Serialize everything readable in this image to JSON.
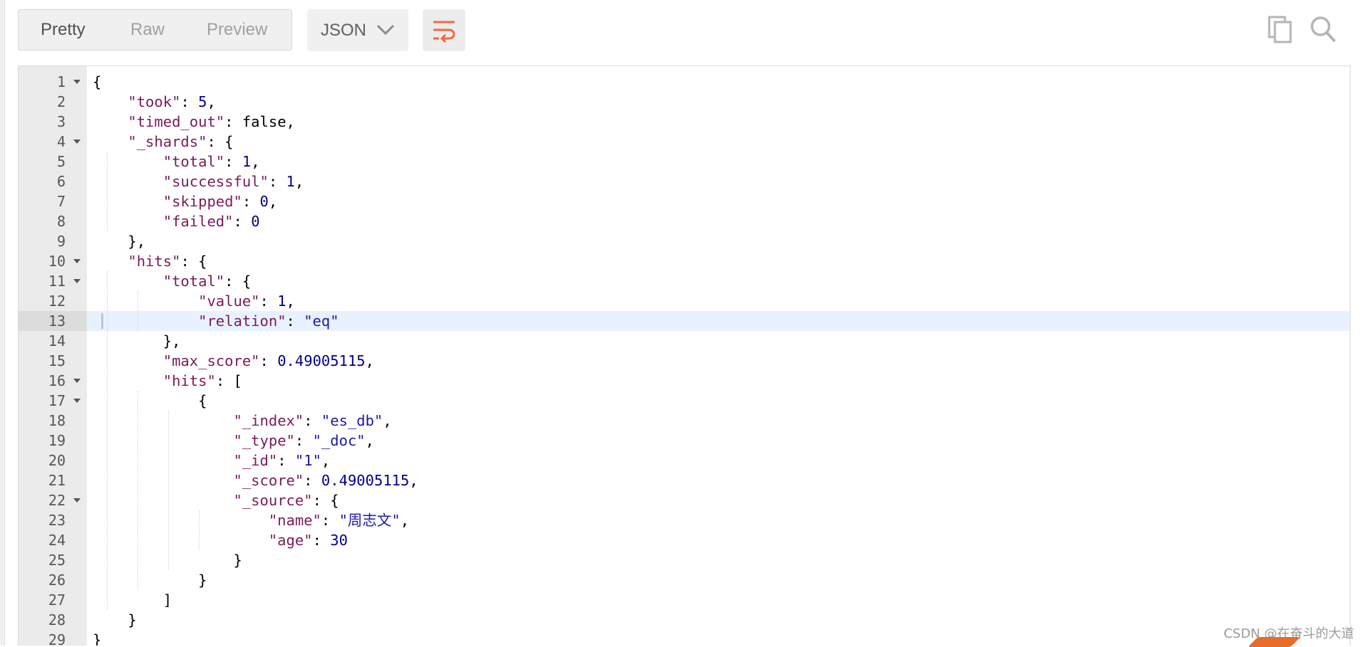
{
  "toolbar": {
    "view_tabs": [
      "Pretty",
      "Raw",
      "Preview"
    ],
    "active_tab": "Pretty",
    "format": "JSON",
    "icons": {
      "format_dropdown": "chevron-down-icon",
      "wrap": "wrap-lines-icon",
      "copy": "copy-icon",
      "search": "search-icon"
    },
    "accent_color": "#f26b3a"
  },
  "editor": {
    "active_line": 13,
    "lines": [
      {
        "n": "1",
        "fold": true
      },
      {
        "n": "2"
      },
      {
        "n": "3"
      },
      {
        "n": "4",
        "fold": true
      },
      {
        "n": "5"
      },
      {
        "n": "6"
      },
      {
        "n": "7"
      },
      {
        "n": "8"
      },
      {
        "n": "9"
      },
      {
        "n": "10",
        "fold": true
      },
      {
        "n": "11",
        "fold": true
      },
      {
        "n": "12"
      },
      {
        "n": "13"
      },
      {
        "n": "14"
      },
      {
        "n": "15"
      },
      {
        "n": "16",
        "fold": true
      },
      {
        "n": "17",
        "fold": true
      },
      {
        "n": "18"
      },
      {
        "n": "19"
      },
      {
        "n": "20"
      },
      {
        "n": "21"
      },
      {
        "n": "22",
        "fold": true
      },
      {
        "n": "23"
      },
      {
        "n": "24"
      },
      {
        "n": "25"
      },
      {
        "n": "26"
      },
      {
        "n": "27"
      },
      {
        "n": "28"
      },
      {
        "n": "29"
      }
    ],
    "code": [
      [
        [
          "p",
          "{"
        ]
      ],
      [
        [
          "i",
          "    "
        ],
        [
          "k",
          "\"took\""
        ],
        [
          "p",
          ": "
        ],
        [
          "n",
          "5"
        ],
        [
          "p",
          ","
        ]
      ],
      [
        [
          "i",
          "    "
        ],
        [
          "k",
          "\"timed_out\""
        ],
        [
          "p",
          ": false,"
        ]
      ],
      [
        [
          "i",
          "    "
        ],
        [
          "k",
          "\"_shards\""
        ],
        [
          "p",
          ": {"
        ]
      ],
      [
        [
          "i",
          "        "
        ],
        [
          "k",
          "\"total\""
        ],
        [
          "p",
          ": "
        ],
        [
          "n",
          "1"
        ],
        [
          "p",
          ","
        ]
      ],
      [
        [
          "i",
          "        "
        ],
        [
          "k",
          "\"successful\""
        ],
        [
          "p",
          ": "
        ],
        [
          "n",
          "1"
        ],
        [
          "p",
          ","
        ]
      ],
      [
        [
          "i",
          "        "
        ],
        [
          "k",
          "\"skipped\""
        ],
        [
          "p",
          ": "
        ],
        [
          "n",
          "0"
        ],
        [
          "p",
          ","
        ]
      ],
      [
        [
          "i",
          "        "
        ],
        [
          "k",
          "\"failed\""
        ],
        [
          "p",
          ": "
        ],
        [
          "n",
          "0"
        ]
      ],
      [
        [
          "i",
          "    "
        ],
        [
          "p",
          "},"
        ]
      ],
      [
        [
          "i",
          "    "
        ],
        [
          "k",
          "\"hits\""
        ],
        [
          "p",
          ": {"
        ]
      ],
      [
        [
          "i",
          "        "
        ],
        [
          "k",
          "\"total\""
        ],
        [
          "p",
          ": {"
        ]
      ],
      [
        [
          "i",
          "            "
        ],
        [
          "k",
          "\"value\""
        ],
        [
          "p",
          ": "
        ],
        [
          "n",
          "1"
        ],
        [
          "p",
          ","
        ]
      ],
      [
        [
          "i",
          "            "
        ],
        [
          "k",
          "\"relation\""
        ],
        [
          "p",
          ": "
        ],
        [
          "s",
          "\"eq\""
        ]
      ],
      [
        [
          "i",
          "        "
        ],
        [
          "p",
          "},"
        ]
      ],
      [
        [
          "i",
          "        "
        ],
        [
          "k",
          "\"max_score\""
        ],
        [
          "p",
          ": "
        ],
        [
          "n",
          "0.49005115"
        ],
        [
          "p",
          ","
        ]
      ],
      [
        [
          "i",
          "        "
        ],
        [
          "k",
          "\"hits\""
        ],
        [
          "p",
          ": ["
        ]
      ],
      [
        [
          "i",
          "            "
        ],
        [
          "p",
          "{"
        ]
      ],
      [
        [
          "i",
          "                "
        ],
        [
          "k",
          "\"_index\""
        ],
        [
          "p",
          ": "
        ],
        [
          "s",
          "\"es_db\""
        ],
        [
          "p",
          ","
        ]
      ],
      [
        [
          "i",
          "                "
        ],
        [
          "k",
          "\"_type\""
        ],
        [
          "p",
          ": "
        ],
        [
          "s",
          "\"_doc\""
        ],
        [
          "p",
          ","
        ]
      ],
      [
        [
          "i",
          "                "
        ],
        [
          "k",
          "\"_id\""
        ],
        [
          "p",
          ": "
        ],
        [
          "s",
          "\"1\""
        ],
        [
          "p",
          ","
        ]
      ],
      [
        [
          "i",
          "                "
        ],
        [
          "k",
          "\"_score\""
        ],
        [
          "p",
          ": "
        ],
        [
          "n",
          "0.49005115"
        ],
        [
          "p",
          ","
        ]
      ],
      [
        [
          "i",
          "                "
        ],
        [
          "k",
          "\"_source\""
        ],
        [
          "p",
          ": {"
        ]
      ],
      [
        [
          "i",
          "                    "
        ],
        [
          "k",
          "\"name\""
        ],
        [
          "p",
          ": "
        ],
        [
          "s",
          "\"周志文\""
        ],
        [
          "p",
          ","
        ]
      ],
      [
        [
          "i",
          "                    "
        ],
        [
          "k",
          "\"age\""
        ],
        [
          "p",
          ": "
        ],
        [
          "n",
          "30"
        ]
      ],
      [
        [
          "i",
          "                "
        ],
        [
          "p",
          "}"
        ]
      ],
      [
        [
          "i",
          "            "
        ],
        [
          "p",
          "}"
        ]
      ],
      [
        [
          "i",
          "        "
        ],
        [
          "p",
          "]"
        ]
      ],
      [
        [
          "i",
          "    "
        ],
        [
          "p",
          "}"
        ]
      ],
      [
        [
          "p",
          "}"
        ]
      ]
    ]
  },
  "watermark": "CSDN @在奋斗的大道"
}
